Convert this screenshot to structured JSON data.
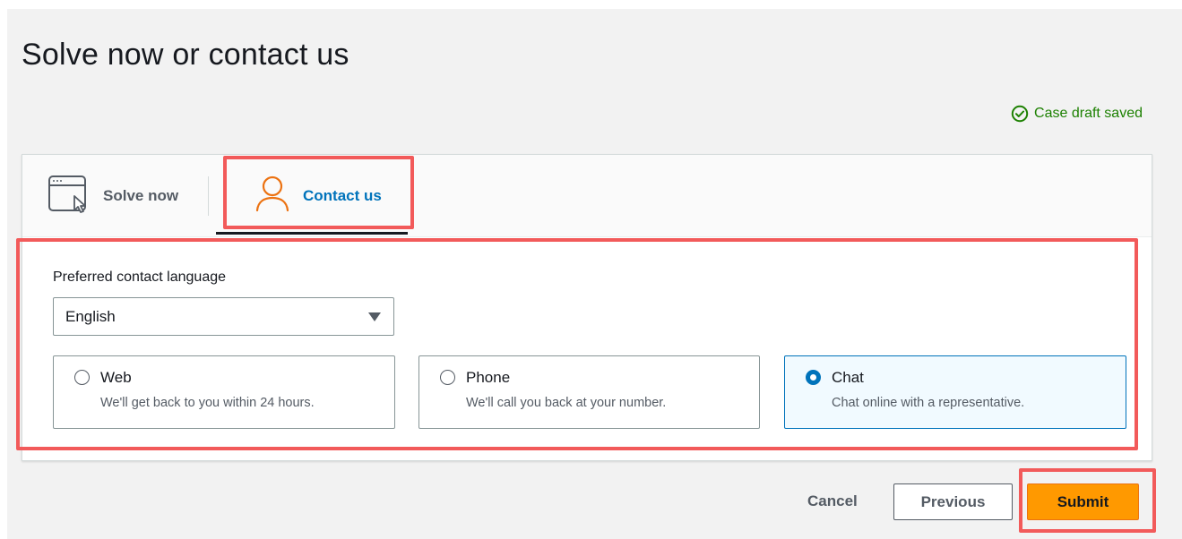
{
  "page": {
    "title": "Solve now or contact us"
  },
  "draft_status": {
    "text": "Case draft saved",
    "icon": "check-circle-icon",
    "color": "#1d8102"
  },
  "tabs": [
    {
      "label": "Solve now",
      "icon": "browser-window-cursor-icon",
      "active": false
    },
    {
      "label": "Contact us",
      "icon": "user-icon",
      "active": true
    }
  ],
  "contact": {
    "language_label": "Preferred contact language",
    "language_value": "English",
    "options": [
      {
        "title": "Web",
        "description": "We'll get back to you within 24 hours.",
        "selected": false
      },
      {
        "title": "Phone",
        "description": "We'll call you back at your number.",
        "selected": false
      },
      {
        "title": "Chat",
        "description": "Chat online with a representative.",
        "selected": true
      }
    ]
  },
  "actions": {
    "cancel": "Cancel",
    "previous": "Previous",
    "submit": "Submit"
  },
  "colors": {
    "accent": "#0073bb",
    "primary_button": "#ff9900",
    "highlight": "#f25a5a",
    "tab_icon": "#ec7211"
  }
}
